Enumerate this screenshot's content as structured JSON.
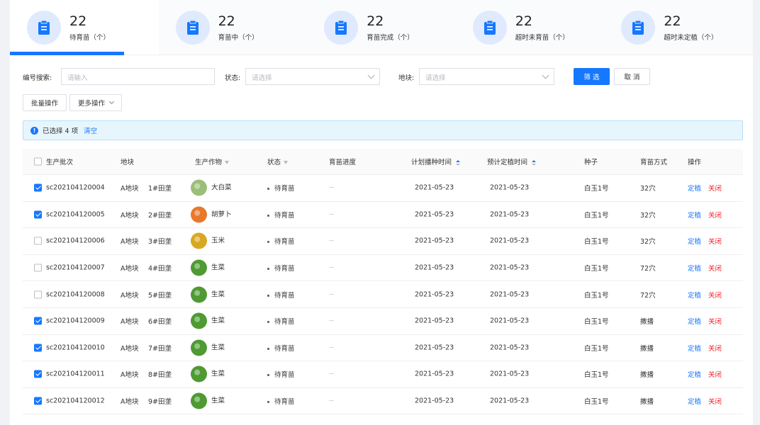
{
  "stats": [
    {
      "num": "22",
      "label": "待育苗（个）",
      "active": true
    },
    {
      "num": "22",
      "label": "育苗中（个）"
    },
    {
      "num": "22",
      "label": "育苗完成（个）"
    },
    {
      "num": "22",
      "label": "超时未育苗（个）"
    },
    {
      "num": "22",
      "label": "超时未定植（个）"
    }
  ],
  "filters": {
    "code_label": "编号搜索:",
    "code_placeholder": "请输入",
    "status_label": "状态:",
    "status_placeholder": "请选择",
    "plot_label": "地块:",
    "plot_placeholder": "请选择",
    "filter_button": "筛 选",
    "cancel_button": "取 消"
  },
  "ops": {
    "batch_label": "批量操作",
    "more_label": "更多操作"
  },
  "alert": {
    "selected_text": "已选择 4 项",
    "clear_label": "清空"
  },
  "table": {
    "headers": {
      "batch": "生产批次",
      "plot": "地块",
      "crop": "生产作物",
      "status": "状态",
      "progress": "育苗进度",
      "sow_time": "计划播种时间",
      "plant_time": "预计定植时间",
      "seed": "种子",
      "method": "育苗方式",
      "action": "操作"
    },
    "rows": [
      {
        "checked": true,
        "batch": "sc202104120004",
        "plot": "A地块",
        "field": "1#田垄",
        "crop": "大白菜",
        "crop_color": "#9bbf7a",
        "status": "待育苗",
        "progress": "--",
        "sow": "2021-05-23",
        "plant": "2021-05-23",
        "seed": "白玉1号",
        "method": "32穴",
        "act1": "定植",
        "act2": "关闭"
      },
      {
        "checked": true,
        "batch": "sc202104120005",
        "plot": "A地块",
        "field": "2#田垄",
        "crop": "胡萝卜",
        "crop_color": "#e9782c",
        "status": "待育苗",
        "progress": "--",
        "sow": "2021-05-23",
        "plant": "2021-05-23",
        "seed": "白玉1号",
        "method": "32穴",
        "act1": "定植",
        "act2": "关闭"
      },
      {
        "checked": false,
        "batch": "sc202104120006",
        "plot": "A地块",
        "field": "3#田垄",
        "crop": "玉米",
        "crop_color": "#d9a821",
        "status": "待育苗",
        "progress": "--",
        "sow": "2021-05-23",
        "plant": "2021-05-23",
        "seed": "白玉1号",
        "method": "32穴",
        "act1": "定植",
        "act2": "关闭"
      },
      {
        "checked": false,
        "batch": "sc202104120007",
        "plot": "A地块",
        "field": "4#田垄",
        "crop": "生菜",
        "crop_color": "#4f9a33",
        "status": "待育苗",
        "progress": "--",
        "sow": "2021-05-23",
        "plant": "2021-05-23",
        "seed": "白玉1号",
        "method": "72穴",
        "act1": "定植",
        "act2": "关闭"
      },
      {
        "checked": false,
        "batch": "sc202104120008",
        "plot": "A地块",
        "field": "5#田垄",
        "crop": "生菜",
        "crop_color": "#4f9a33",
        "status": "待育苗",
        "progress": "--",
        "sow": "2021-05-23",
        "plant": "2021-05-23",
        "seed": "白玉1号",
        "method": "72穴",
        "act1": "定植",
        "act2": "关闭"
      },
      {
        "checked": true,
        "batch": "sc202104120009",
        "plot": "A地块",
        "field": "6#田垄",
        "crop": "生菜",
        "crop_color": "#4f9a33",
        "status": "待育苗",
        "progress": "--",
        "sow": "2021-05-23",
        "plant": "2021-05-23",
        "seed": "白玉1号",
        "method": "撒播",
        "act1": "定植",
        "act2": "关闭"
      },
      {
        "checked": true,
        "batch": "sc202104120010",
        "plot": "A地块",
        "field": "7#田垄",
        "crop": "生菜",
        "crop_color": "#4f9a33",
        "status": "待育苗",
        "progress": "--",
        "sow": "2021-05-23",
        "plant": "2021-05-23",
        "seed": "白玉1号",
        "method": "撒播",
        "act1": "定植",
        "act2": "关闭"
      },
      {
        "checked": true,
        "batch": "sc202104120011",
        "plot": "A地块",
        "field": "8#田垄",
        "crop": "生菜",
        "crop_color": "#4f9a33",
        "status": "待育苗",
        "progress": "--",
        "sow": "2021-05-23",
        "plant": "2021-05-23",
        "seed": "白玉1号",
        "method": "撒播",
        "act1": "定植",
        "act2": "关闭"
      },
      {
        "checked": true,
        "batch": "sc202104120012",
        "plot": "A地块",
        "field": "9#田垄",
        "crop": "生菜",
        "crop_color": "#4f9a33",
        "status": "待育苗",
        "progress": "--",
        "sow": "2021-05-23",
        "plant": "2021-05-23",
        "seed": "白玉1号",
        "method": "撒播",
        "act1": "定植",
        "act2": "关闭"
      }
    ]
  },
  "colors": {
    "primary": "#1677ff",
    "danger": "#f5222d",
    "alert_bg": "#e7f6fd"
  }
}
